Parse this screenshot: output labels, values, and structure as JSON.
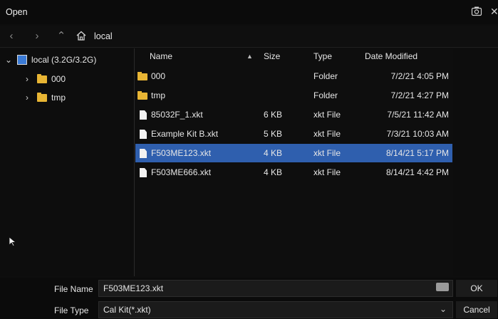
{
  "window": {
    "title": "Open"
  },
  "address": {
    "path": "local"
  },
  "tree": {
    "root": {
      "label": "local  (3.2G/3.2G)"
    },
    "children": [
      {
        "label": "000"
      },
      {
        "label": "tmp"
      }
    ]
  },
  "columns": {
    "name": "Name",
    "size": "Size",
    "type": "Type",
    "date": "Date Modified"
  },
  "files": [
    {
      "name": "000",
      "size": "",
      "type": "Folder",
      "date": "7/2/21 4:05 PM",
      "kind": "folder"
    },
    {
      "name": "tmp",
      "size": "",
      "type": "Folder",
      "date": "7/2/21 4:27 PM",
      "kind": "folder"
    },
    {
      "name": "85032F_1.xkt",
      "size": "6 KB",
      "type": "xkt File",
      "date": "7/5/21 11:42 AM",
      "kind": "file"
    },
    {
      "name": "Example Kit B.xkt",
      "size": "5 KB",
      "type": "xkt File",
      "date": "7/3/21 10:03 AM",
      "kind": "file"
    },
    {
      "name": "F503ME123.xkt",
      "size": "4 KB",
      "type": "xkt File",
      "date": "8/14/21 5:17 PM",
      "kind": "file",
      "selected": true
    },
    {
      "name": "F503ME666.xkt",
      "size": "4 KB",
      "type": "xkt File",
      "date": "8/14/21 4:42 PM",
      "kind": "file"
    }
  ],
  "bottom": {
    "file_name_label": "File Name",
    "file_name_value": "F503ME123.xkt",
    "file_type_label": "File Type",
    "file_type_value": "Cal Kit(*.xkt)",
    "ok_label": "OK",
    "cancel_label": "Cancel"
  },
  "colors": {
    "accent": "#2f5fae",
    "folder": "#e8b534"
  }
}
